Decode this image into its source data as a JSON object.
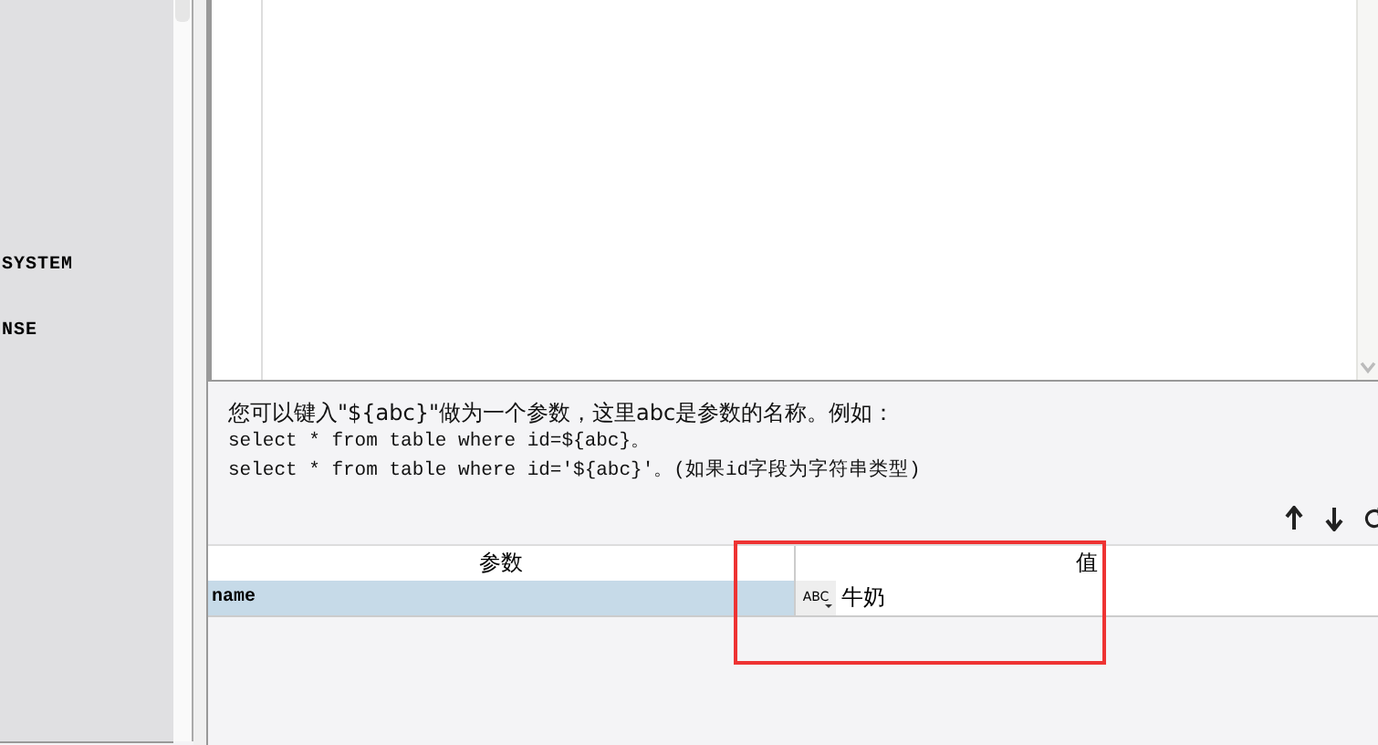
{
  "tree": {
    "items": [
      {
        "label": "SYSTEM"
      },
      {
        "label": "NSE"
      }
    ]
  },
  "help": {
    "lines": [
      "您可以键入\"${abc}\"做为一个参数，这里abc是参数的名称。例如：",
      "select * from table where id=${abc}。",
      "select * from table where id='${abc}'。(如果id字段为字符串类型)"
    ]
  },
  "table": {
    "columns": [
      "参数",
      "值"
    ],
    "rows": [
      {
        "name": "name",
        "type": "ABC",
        "value": "牛奶",
        "selected": true
      }
    ]
  },
  "annotation": {
    "color": "#ee3333"
  }
}
